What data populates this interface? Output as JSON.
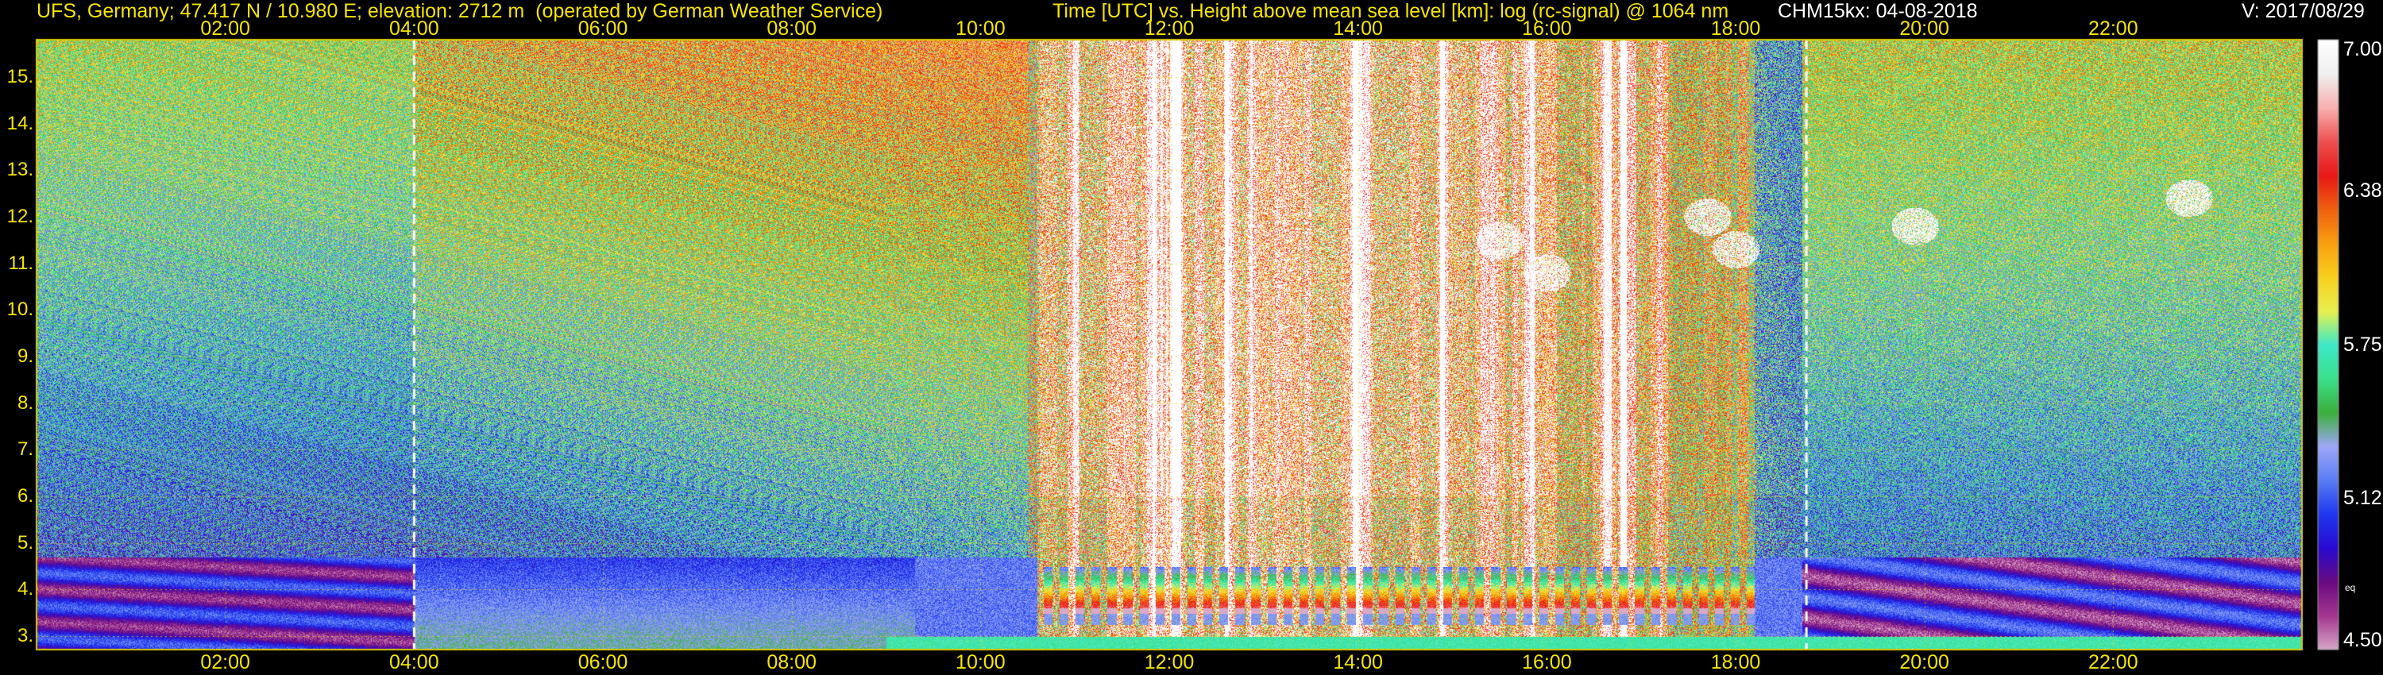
{
  "header": {
    "station": "UFS, Germany; 47.417 N / 10.980 E; elevation: 2712 m  (operated by German Weather Service)",
    "title": "Time [UTC] vs. Height above mean sea level [km]: log (rc-signal) @ 1064 nm",
    "instrument": "CHM15kx: 04-08-2018",
    "version": "V: 2017/08/29"
  },
  "chart_data": {
    "type": "heatmap",
    "title": "Time [UTC] vs. Height above mean sea level [km]: log (rc-signal) @ 1064 nm",
    "x_range_hours": [
      0,
      24
    ],
    "x_ticks": [
      "02:00",
      "04:00",
      "06:00",
      "08:00",
      "10:00",
      "12:00",
      "14:00",
      "16:00",
      "18:00",
      "20:00",
      "22:00"
    ],
    "x_tick_hours": [
      2,
      4,
      6,
      8,
      10,
      12,
      14,
      16,
      18,
      20,
      22
    ],
    "y_range_km": [
      2.712,
      15.8
    ],
    "y_ticks": [
      "3.",
      "4.",
      "5.",
      "6.",
      "7.",
      "8.",
      "9.",
      "10.",
      "11.",
      "12.",
      "13.",
      "14.",
      "15."
    ],
    "y_tick_values": [
      3,
      4,
      5,
      6,
      7,
      8,
      9,
      10,
      11,
      12,
      13,
      14,
      15
    ],
    "grid": true,
    "dashed_time_markers_hours": [
      4.0,
      18.75
    ],
    "colorbar": {
      "range": [
        4.5,
        7.0
      ],
      "tick_labels": [
        "7.00",
        "6.38",
        "5.75",
        "5.12",
        "4.50"
      ],
      "tick_values": [
        7.0,
        6.38,
        5.75,
        5.12,
        4.5
      ],
      "side_label": "eq",
      "colors": [
        "#d8a8c8",
        "#a43890",
        "#6a0a80",
        "#2a0ad0",
        "#2038f0",
        "#5a7cf4",
        "#a0a8f8",
        "#3cae3c",
        "#3ce08c",
        "#3ce8c8",
        "#e8f050",
        "#f8d020",
        "#f8a010",
        "#f06010",
        "#e81818",
        "#ee5050",
        "#f8b0b0",
        "#f0f0f0",
        "#ffffff"
      ]
    },
    "features": {
      "boundary_layer_top_km": 3.6,
      "cloud_bursts_hours": [
        10.6,
        18.1
      ],
      "cirrus_patches": [
        {
          "t": 15.5,
          "h": 11.5
        },
        {
          "t": 16.0,
          "h": 10.8
        },
        {
          "t": 17.7,
          "h": 12.0
        },
        {
          "t": 18.0,
          "h": 11.3
        },
        {
          "t": 22.8,
          "h": 12.4
        },
        {
          "t": 19.9,
          "h": 11.8
        }
      ]
    }
  }
}
